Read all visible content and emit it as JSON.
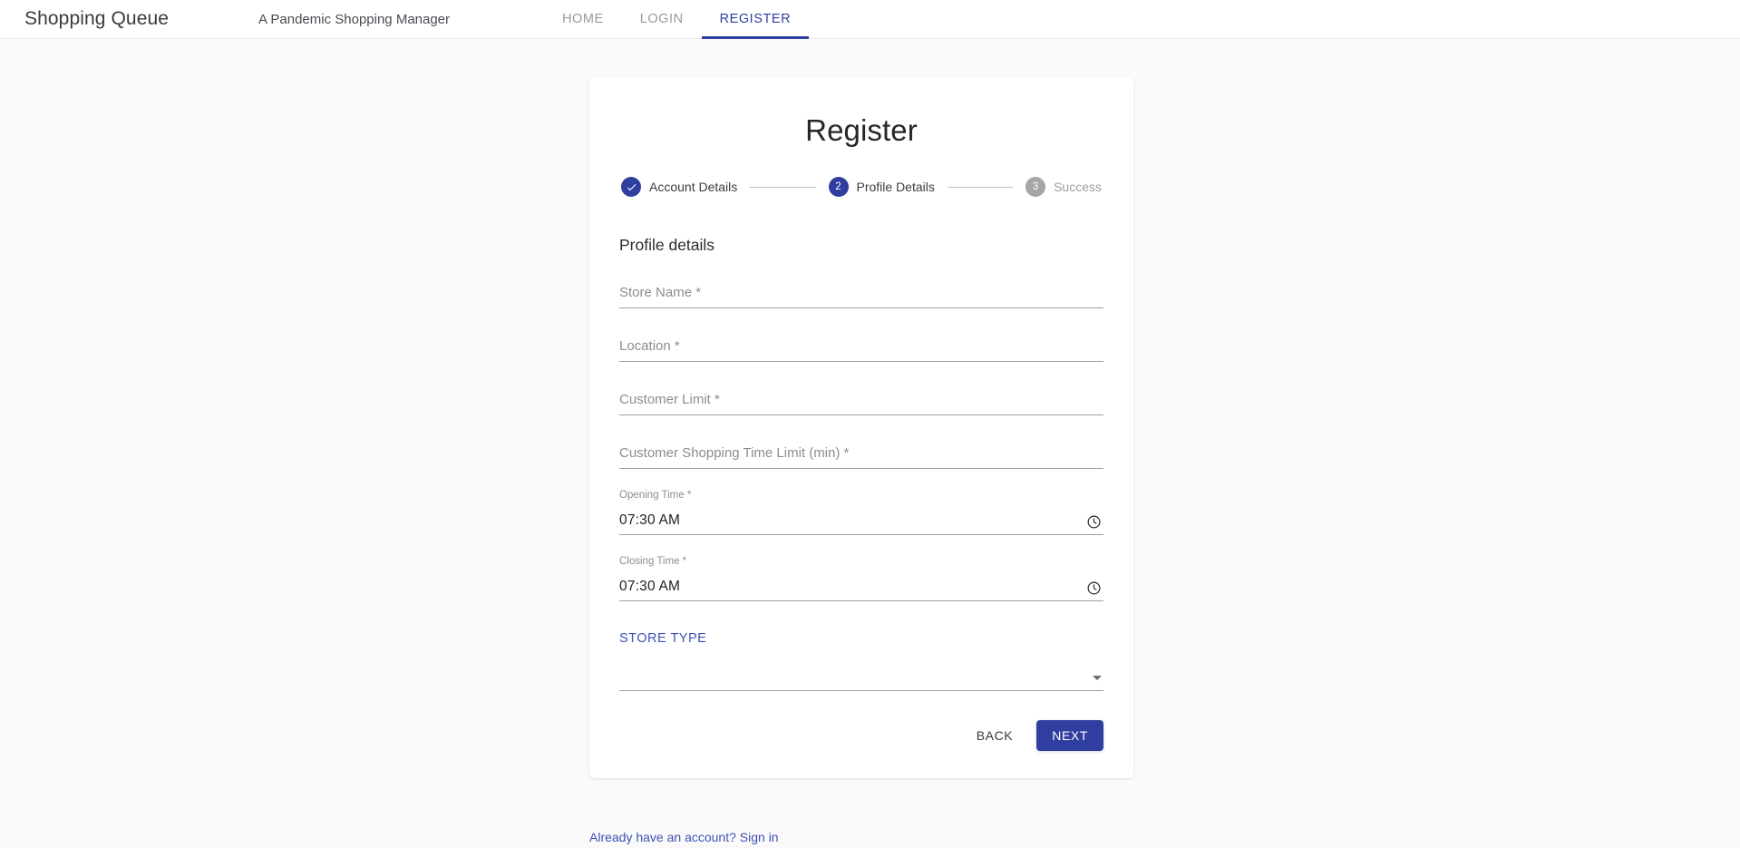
{
  "appbar": {
    "brand": "Shopping Queue",
    "subtitle": "A Pandemic Shopping Manager",
    "nav": [
      {
        "label": "HOME",
        "active": false
      },
      {
        "label": "LOGIN",
        "active": false
      },
      {
        "label": "REGISTER",
        "active": true
      }
    ]
  },
  "card": {
    "title": "Register",
    "stepper": [
      {
        "number": "1",
        "label": "Account Details",
        "state": "done"
      },
      {
        "number": "2",
        "label": "Profile Details",
        "state": "active"
      },
      {
        "number": "3",
        "label": "Success",
        "state": "todo"
      }
    ],
    "section_title": "Profile details",
    "fields": [
      {
        "label": "Store Name",
        "required": "*",
        "value": ""
      },
      {
        "label": "Location",
        "required": "*",
        "value": ""
      },
      {
        "label": "Customer Limit",
        "required": "*",
        "value": ""
      },
      {
        "label": "Customer Shopping Time Limit (min)",
        "required": "*",
        "value": ""
      }
    ],
    "time_fields": [
      {
        "label": "Opening Time",
        "required": "*",
        "value": "07:30 AM",
        "icon": "clock-icon"
      },
      {
        "label": "Closing Time",
        "required": "*",
        "value": "07:30 AM",
        "icon": "clock-icon"
      }
    ],
    "store_type": {
      "label": "STORE TYPE",
      "value": "",
      "icon": "chevron-down-icon"
    },
    "buttons": {
      "back": "BACK",
      "next": "NEXT"
    }
  },
  "footer": {
    "signin": "Already have an account? Sign in"
  },
  "colors": {
    "accent": "#303f9f",
    "link": "#3f51b5",
    "inactive_step": "#a6a6a6",
    "page_background": "#fafafa",
    "card_background": "#ffffff"
  }
}
